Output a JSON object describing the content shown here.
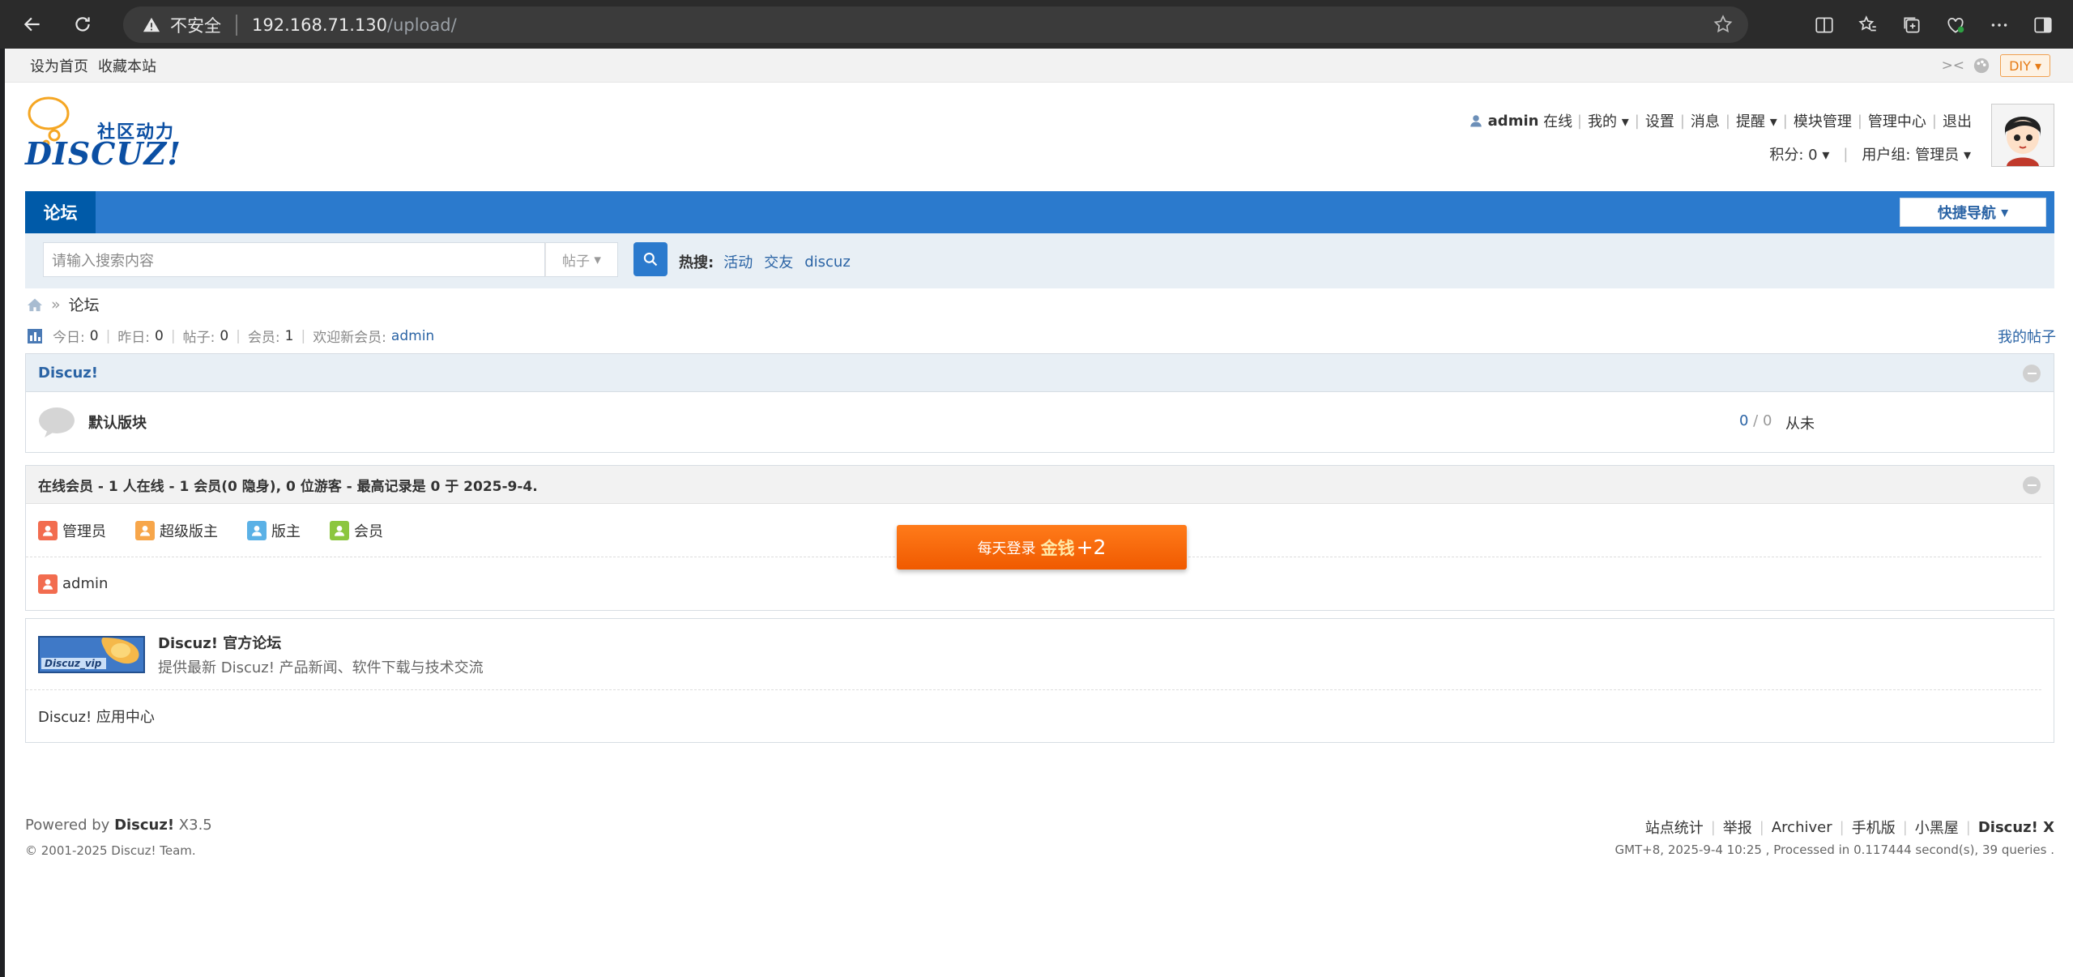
{
  "browser": {
    "security_label": "不安全",
    "url_host": "192.168.71.130",
    "url_path": "/upload/"
  },
  "toptb": {
    "set_home": "设为首页",
    "bookmark": "收藏本站",
    "mini_label": ">< ",
    "diy": "DIY"
  },
  "header": {
    "logo_tagline": "社区动力",
    "logo_text": "DISCUZ!",
    "username": "admin",
    "online": "在线",
    "menu": [
      "我的",
      "设置",
      "消息",
      "提醒",
      "模块管理",
      "管理中心",
      "退出"
    ],
    "credits": "积分: 0",
    "usergroup": "用户组: 管理员"
  },
  "nav": {
    "active_tab": "论坛",
    "quick_nav": "快捷导航"
  },
  "search": {
    "placeholder": "请输入搜索内容",
    "type": "帖子",
    "hot_label": "热搜:",
    "hot_words": [
      "活动",
      "交友",
      "discuz"
    ]
  },
  "breadcrumb": {
    "current": "论坛"
  },
  "stats": {
    "today_label": "今日:",
    "today": "0",
    "yesterday_label": "昨日:",
    "yesterday": "0",
    "posts_label": "帖子:",
    "posts": "0",
    "members_label": "会员:",
    "members": "1",
    "welcome_label": "欢迎新会员:",
    "new_member": "admin",
    "my_posts": "我的帖子"
  },
  "forum_group": {
    "title": "Discuz!",
    "forums": [
      {
        "name": "默认版块",
        "threads": "0",
        "posts": "0",
        "last": "从未"
      }
    ]
  },
  "online": {
    "summary": "在线会员 - 1 人在线 - 1 会员(0 隐身), 0 位游客 - 最高记录是 0 于 2025-9-4.",
    "legend": [
      {
        "label": "管理员",
        "color": "#f26c4f"
      },
      {
        "label": "超级版主",
        "color": "#f7a64a"
      },
      {
        "label": "版主",
        "color": "#5bb1e6"
      },
      {
        "label": "会员",
        "color": "#8cc63f"
      }
    ],
    "users": [
      "admin"
    ]
  },
  "links": {
    "vip_text": "Discuz_vip",
    "site_title": "Discuz! 官方论坛",
    "site_desc": "提供最新 Discuz! 产品新闻、软件下载与技术交流",
    "app_center": "Discuz! 应用中心"
  },
  "promo": {
    "prefix": "每天登录",
    "reward": "金钱",
    "amount": "+2"
  },
  "footer": {
    "powered_prefix": "Powered by",
    "powered_brand": "Discuz!",
    "powered_version": "X3.5",
    "copyright": "© 2001-2025 Discuz! Team.",
    "nav": [
      "站点统计",
      "举报",
      "Archiver",
      "手机版",
      "小黑屋"
    ],
    "brand": "Discuz! X",
    "processed": "GMT+8, 2025-9-4 10:25 , Processed in 0.117444 second(s), 39 queries ."
  }
}
